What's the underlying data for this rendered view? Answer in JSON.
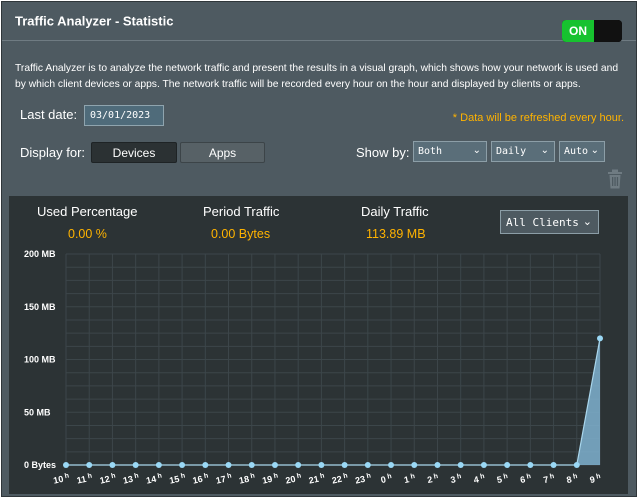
{
  "header": {
    "title": "Traffic Analyzer - Statistic",
    "toggle_label": "ON"
  },
  "description": "Traffic Analyzer is to analyze the network traffic and present the results in a visual graph, which shows how your network is used and by which client devices or apps. The network traffic will be recorded every hour on the hour and displayed by clients or apps.",
  "last_date": {
    "label": "Last date:",
    "value": "03/01/2023"
  },
  "refresh_note": "* Data will be refreshed every hour.",
  "display_for": {
    "label": "Display for:",
    "devices": "Devices",
    "apps": "Apps"
  },
  "show_by": {
    "label": "Show by:",
    "direction": "Both",
    "period": "Daily",
    "mode": "Auto"
  },
  "stats": {
    "used_percentage_label": "Used Percentage",
    "used_percentage_value": "0.00 %",
    "period_traffic_label": "Period Traffic",
    "period_traffic_value": "0.00 Bytes",
    "daily_traffic_label": "Daily Traffic",
    "daily_traffic_value": "113.89 MB"
  },
  "clients_select": "All Clients",
  "colors": {
    "accent": "#ffb300",
    "toggle_on": "#17c22f",
    "area_fill": "#7fb2cf",
    "point": "#9ad8f5"
  },
  "chart_data": {
    "type": "area",
    "x": [
      "10",
      "11",
      "12",
      "13",
      "14",
      "15",
      "16",
      "17",
      "18",
      "19",
      "20",
      "21",
      "22",
      "23",
      "0",
      "1",
      "2",
      "3",
      "4",
      "5",
      "6",
      "7",
      "8",
      "9"
    ],
    "x_unit": "h",
    "y_ticks": [
      "0 Bytes",
      "50 MB",
      "100 MB",
      "150 MB",
      "200 MB"
    ],
    "ylim": [
      0,
      200
    ],
    "values": [
      0,
      0,
      0,
      0,
      0,
      0,
      0,
      0,
      0,
      0,
      0,
      0,
      0,
      0,
      0,
      0,
      0,
      0,
      0,
      0,
      0,
      0,
      0,
      120
    ],
    "grid": true
  }
}
